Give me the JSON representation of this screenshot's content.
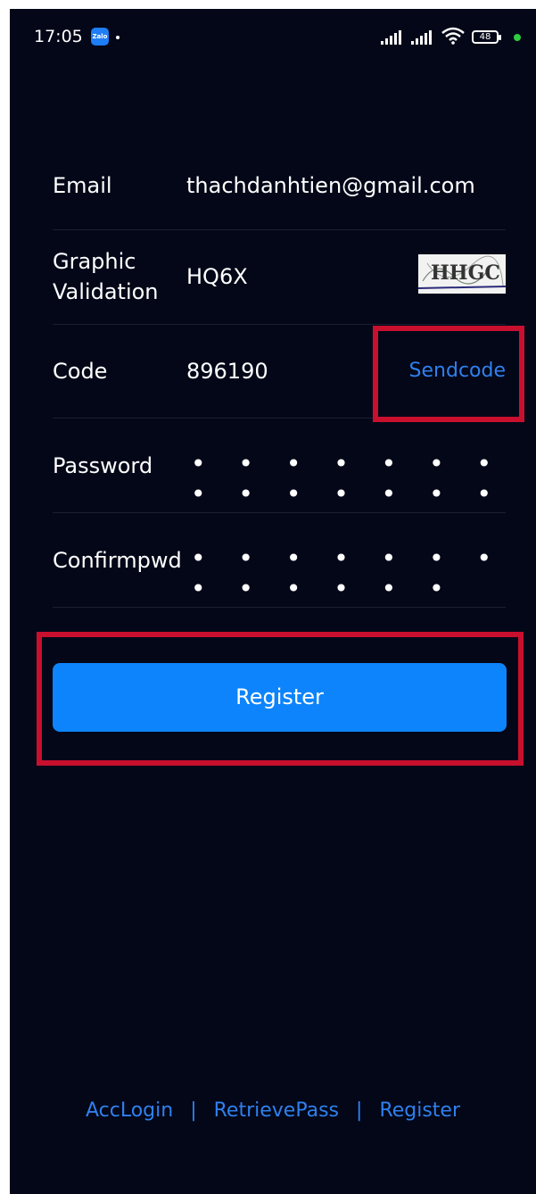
{
  "status_bar": {
    "time": "17:05",
    "app_badge": "Zalo",
    "battery": "48"
  },
  "form": {
    "email": {
      "label": "Email",
      "value": "thachdanhtien@gmail.com"
    },
    "graphic": {
      "label_line1": "Graphic",
      "label_line2": "Validation",
      "value": "HQ6X",
      "captcha_text": "HHGC"
    },
    "code": {
      "label": "Code",
      "value": "896190",
      "send_label": "Sendcode"
    },
    "password": {
      "label": "Password",
      "masked": "• • • • • • • • • • • • • •"
    },
    "confirm": {
      "label": "Confirmpwd",
      "masked": "• • • • • • • • • • • • •"
    }
  },
  "register_button": "Register",
  "footer": {
    "acc_login": "AccLogin",
    "retrieve": "RetrievePass",
    "register": "Register",
    "separator": "|"
  },
  "colors": {
    "background": "#030718",
    "accent": "#0d84fb",
    "link": "#2f80ed",
    "highlight": "#c8102e"
  }
}
